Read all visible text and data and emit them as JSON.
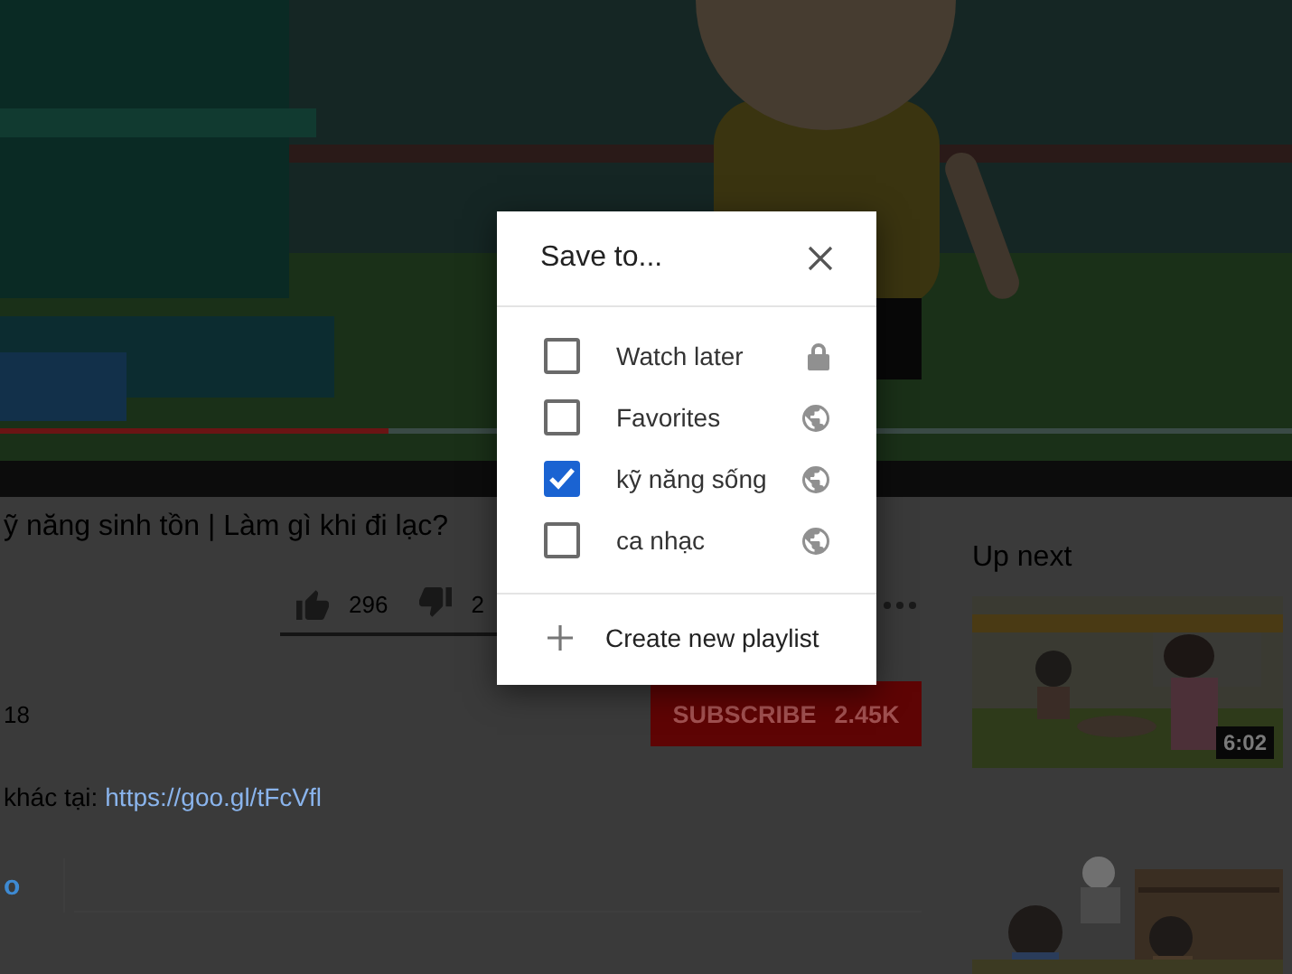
{
  "player": {
    "level": 0.3
  },
  "video_info": {
    "title": "ỹ năng sinh tồn | Làm gì khi đi lạc?",
    "likes": "296",
    "dislikes": "2",
    "date": "18",
    "subscribe_button": "SUBSCRIBE",
    "subscriber_count": "2.45K",
    "description": "khác tại:",
    "description_link": "https://goo.gl/tFcVfl",
    "show_more": "o"
  },
  "sidebar": {
    "heading": "Up next",
    "videos": [
      {
        "kind": "picture",
        "duration": "6:02"
      },
      {
        "kind": "picture"
      }
    ]
  },
  "dialog": {
    "title": "Save to...",
    "playlists": [
      {
        "name": "Watch later",
        "checked": false,
        "kind": "private"
      },
      {
        "name": "Favorites",
        "checked": false,
        "kind": "public"
      },
      {
        "name": "kỹ năng sống",
        "checked": true,
        "kind": "public"
      },
      {
        "name": "ca nhạc",
        "checked": false,
        "kind": "public"
      }
    ],
    "create_button": "Create new playlist"
  }
}
